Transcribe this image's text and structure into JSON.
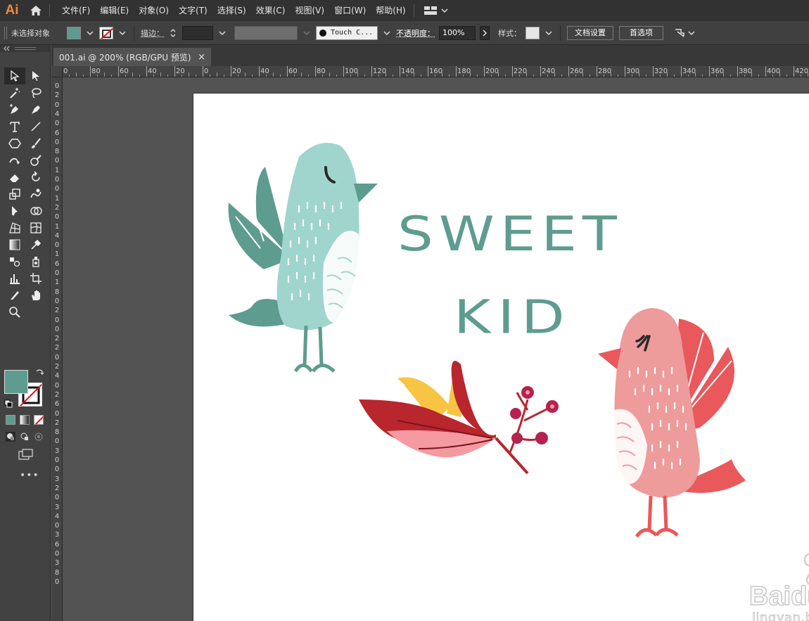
{
  "app": {
    "logo": "Ai"
  },
  "menu": [
    "文件(F)",
    "编辑(E)",
    "对象(O)",
    "文字(T)",
    "选择(S)",
    "效果(C)",
    "视图(V)",
    "窗口(W)",
    "帮助(H)"
  ],
  "control_bar": {
    "selection_label": "未选择对象",
    "stroke_label": "描边：",
    "brush_name": "Touch C...",
    "opacity_label": "不透明度：",
    "opacity_value": "100%",
    "style_label": "样式：",
    "doc_setup_button": "文档设置",
    "preferences_button": "首选项"
  },
  "document_tab": {
    "title": "001.ai @ 200% (RGB/GPU 预览)",
    "close": "×"
  },
  "ruler": {
    "h_ticks": [
      "0",
      "80",
      "60",
      "40",
      "20",
      "0",
      "20",
      "40",
      "60",
      "80",
      "100",
      "120",
      "140",
      "160",
      "180",
      "200",
      "220",
      "240",
      "260",
      "280",
      "300",
      "320",
      "340",
      "360",
      "380",
      "400",
      "420"
    ],
    "v_ticks": [
      "0",
      "2",
      "0",
      "4",
      "0",
      "6",
      "0",
      "8",
      "0",
      "1",
      "0",
      "0",
      "1",
      "2",
      "0",
      "1",
      "4",
      "0",
      "1",
      "6",
      "0",
      "1",
      "8",
      "0",
      "2",
      "0",
      "0",
      "2",
      "2",
      "0",
      "2",
      "4",
      "0",
      "2",
      "6",
      "0",
      "2",
      "8",
      "0",
      "3",
      "0",
      "0",
      "3",
      "2",
      "0",
      "3",
      "4",
      "0",
      "3",
      "6",
      "0",
      "3",
      "8",
      "0"
    ]
  },
  "artwork": {
    "line1": "SWEET",
    "line2": "KID"
  },
  "watermark": {
    "brand": "Baidu 经验",
    "url": "jingyan.baidu.com"
  },
  "colors": {
    "fill": "#5e9c8f",
    "teal_bird": "#9fd5cd",
    "teal_dark": "#5e9c8f",
    "pink_bird": "#ee9b9b",
    "coral": "#e9585a",
    "leaf_red": "#b9262e",
    "leaf_pink": "#f49aa0",
    "yellow": "#f7c444",
    "berry": "#b5224f"
  },
  "tools": [
    "selection-tool",
    "direct-selection-tool",
    "magic-wand-tool",
    "lasso-tool",
    "pen-tool",
    "curvature-tool",
    "type-tool",
    "line-tool",
    "shape-tool",
    "paintbrush-tool",
    "shaper-tool",
    "blob-brush-tool",
    "eraser-tool",
    "rotate-tool",
    "scale-tool",
    "warp-tool",
    "puppet-warp-tool",
    "shape-builder-tool",
    "perspective-grid-tool",
    "mesh-tool",
    "gradient-tool",
    "eyedropper-tool",
    "blend-tool",
    "symbol-sprayer-tool",
    "graph-tool",
    "artboard-tool",
    "slice-tool",
    "hand-tool",
    "zoom-tool"
  ]
}
